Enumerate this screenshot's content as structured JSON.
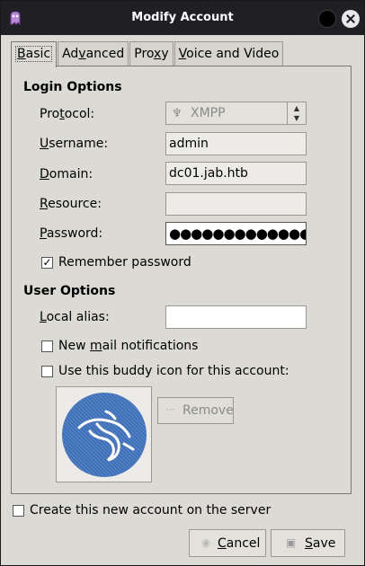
{
  "window": {
    "title": "Modify Account"
  },
  "tabs": [
    {
      "label": "Basic",
      "mnemonic": "B",
      "rest": "asic"
    },
    {
      "label": "Advanced",
      "mnemonic": "v",
      "pre": "Ad",
      "rest": "anced"
    },
    {
      "label": "Proxy",
      "mnemonic": "x",
      "pre": "Pro",
      "rest": "y"
    },
    {
      "label": "Voice and Video",
      "mnemonic": "V",
      "rest": "oice and Video"
    }
  ],
  "login_options": {
    "title": "Login Options",
    "protocol": {
      "label": "Protocol:",
      "value": "XMPP"
    },
    "username": {
      "label": "Username:",
      "value": "admin"
    },
    "domain": {
      "label": "Domain:",
      "value": "dc01.jab.htb"
    },
    "resource": {
      "label": "Resource:",
      "value": ""
    },
    "password": {
      "label": "Password:",
      "value": "●●●●●●●●●●●●●●●●●●●"
    },
    "remember": {
      "label": "Remember password",
      "checked": true
    }
  },
  "user_options": {
    "title": "User Options",
    "local_alias": {
      "label": "Local alias:",
      "value": ""
    },
    "new_mail": {
      "label": "New mail notifications",
      "checked": false
    },
    "buddy_icon": {
      "label": "Use this buddy icon for this account:",
      "checked": false
    },
    "remove_label": "Remove"
  },
  "footer": {
    "create_account": {
      "label": "Create this new account on the server",
      "checked": false
    },
    "cancel_label": "Cancel",
    "save_label": "Save"
  },
  "colors": {
    "titlebar": "#1f1f24",
    "dialog": "#dcdad5",
    "buddy_icon_fill": "#3f6fb6"
  }
}
